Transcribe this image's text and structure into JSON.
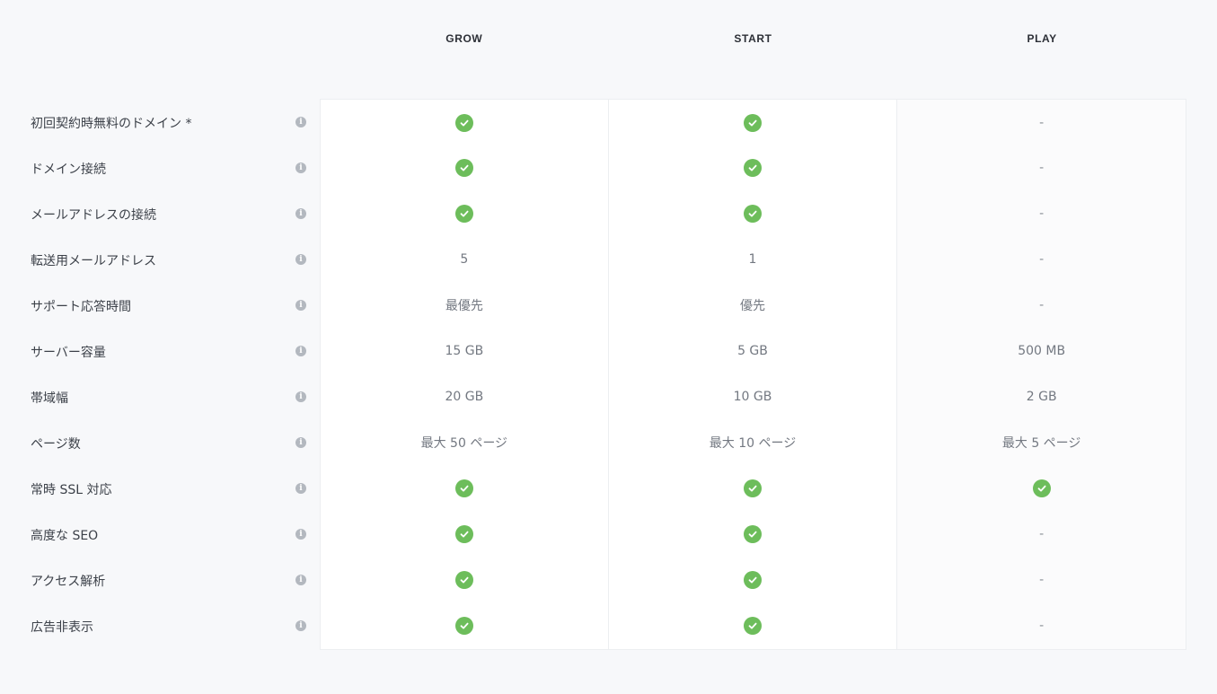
{
  "plans": [
    "GROW",
    "START",
    "PLAY"
  ],
  "features": [
    {
      "label": "初回契約時無料のドメイン *",
      "values": [
        "check",
        "check",
        "-"
      ]
    },
    {
      "label": "ドメイン接続",
      "values": [
        "check",
        "check",
        "-"
      ]
    },
    {
      "label": "メールアドレスの接続",
      "values": [
        "check",
        "check",
        "-"
      ]
    },
    {
      "label": "転送用メールアドレス",
      "values": [
        "5",
        "1",
        "-"
      ]
    },
    {
      "label": "サポート応答時間",
      "values": [
        "最優先",
        "優先",
        "-"
      ]
    },
    {
      "label": "サーバー容量",
      "values": [
        "15 GB",
        "5 GB",
        "500 MB"
      ]
    },
    {
      "label": "帯域幅",
      "values": [
        "20 GB",
        "10 GB",
        "2 GB"
      ]
    },
    {
      "label": "ページ数",
      "values": [
        "最大 50 ページ",
        "最大 10 ページ",
        "最大 5 ページ"
      ]
    },
    {
      "label": "常時 SSL 対応",
      "values": [
        "check",
        "check",
        "check"
      ]
    },
    {
      "label": "高度な SEO",
      "values": [
        "check",
        "check",
        "-"
      ]
    },
    {
      "label": "アクセス解析",
      "values": [
        "check",
        "check",
        "-"
      ]
    },
    {
      "label": "広告非表示",
      "values": [
        "check",
        "check",
        "-"
      ]
    }
  ],
  "icons": {
    "info": "info-icon",
    "check": "check-circle-icon"
  },
  "colors": {
    "check": "#6dbd5b",
    "info": "#b3b8bf"
  }
}
